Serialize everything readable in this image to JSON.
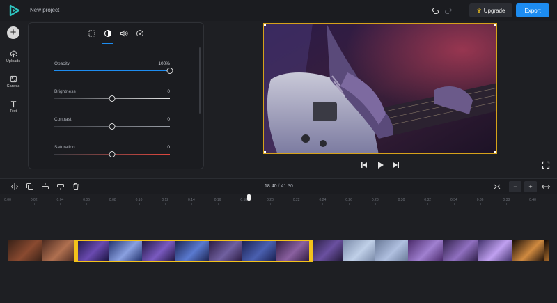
{
  "app": {
    "project_title": "New project",
    "upgrade_label": "Upgrade",
    "export_label": "Export",
    "accent_color": "#1d8cf0",
    "selection_color": "#f3c21b"
  },
  "rail": {
    "add_label": "+",
    "items": [
      {
        "label": "Uploads",
        "icon": "upload-icon"
      },
      {
        "label": "Canvas",
        "icon": "canvas-icon"
      },
      {
        "label": "Text",
        "icon": "text-icon"
      }
    ]
  },
  "panel": {
    "tabs": [
      "crop-icon",
      "adjust-icon",
      "volume-icon",
      "speed-icon"
    ],
    "active_tab": "adjust-icon",
    "sliders": [
      {
        "label": "Opacity",
        "value": "100%",
        "fraction": 1.0,
        "color": "#1d8cf0"
      },
      {
        "label": "Brightness",
        "value": "0",
        "fraction": 0.5,
        "color": "#e6e6e6"
      },
      {
        "label": "Contrast",
        "value": "0",
        "fraction": 0.5,
        "color": "#9a9ea6"
      },
      {
        "label": "Saturation",
        "value": "0",
        "fraction": 0.5,
        "color": "#e0473e"
      }
    ]
  },
  "timeline": {
    "current_time": "18.40",
    "separator": "/",
    "total_time": "41.30",
    "zoom_minus": "−",
    "zoom_plus": "+",
    "ticks": [
      "0:00",
      "0:02",
      "0:04",
      "0:06",
      "0:08",
      "0:10",
      "0:12",
      "0:14",
      "0:16",
      "0:18",
      "0:20",
      "0:22",
      "0:24",
      "0:26",
      "0:28",
      "0:30",
      "0:32",
      "0:34",
      "0:36",
      "0:38",
      "0:40"
    ]
  }
}
